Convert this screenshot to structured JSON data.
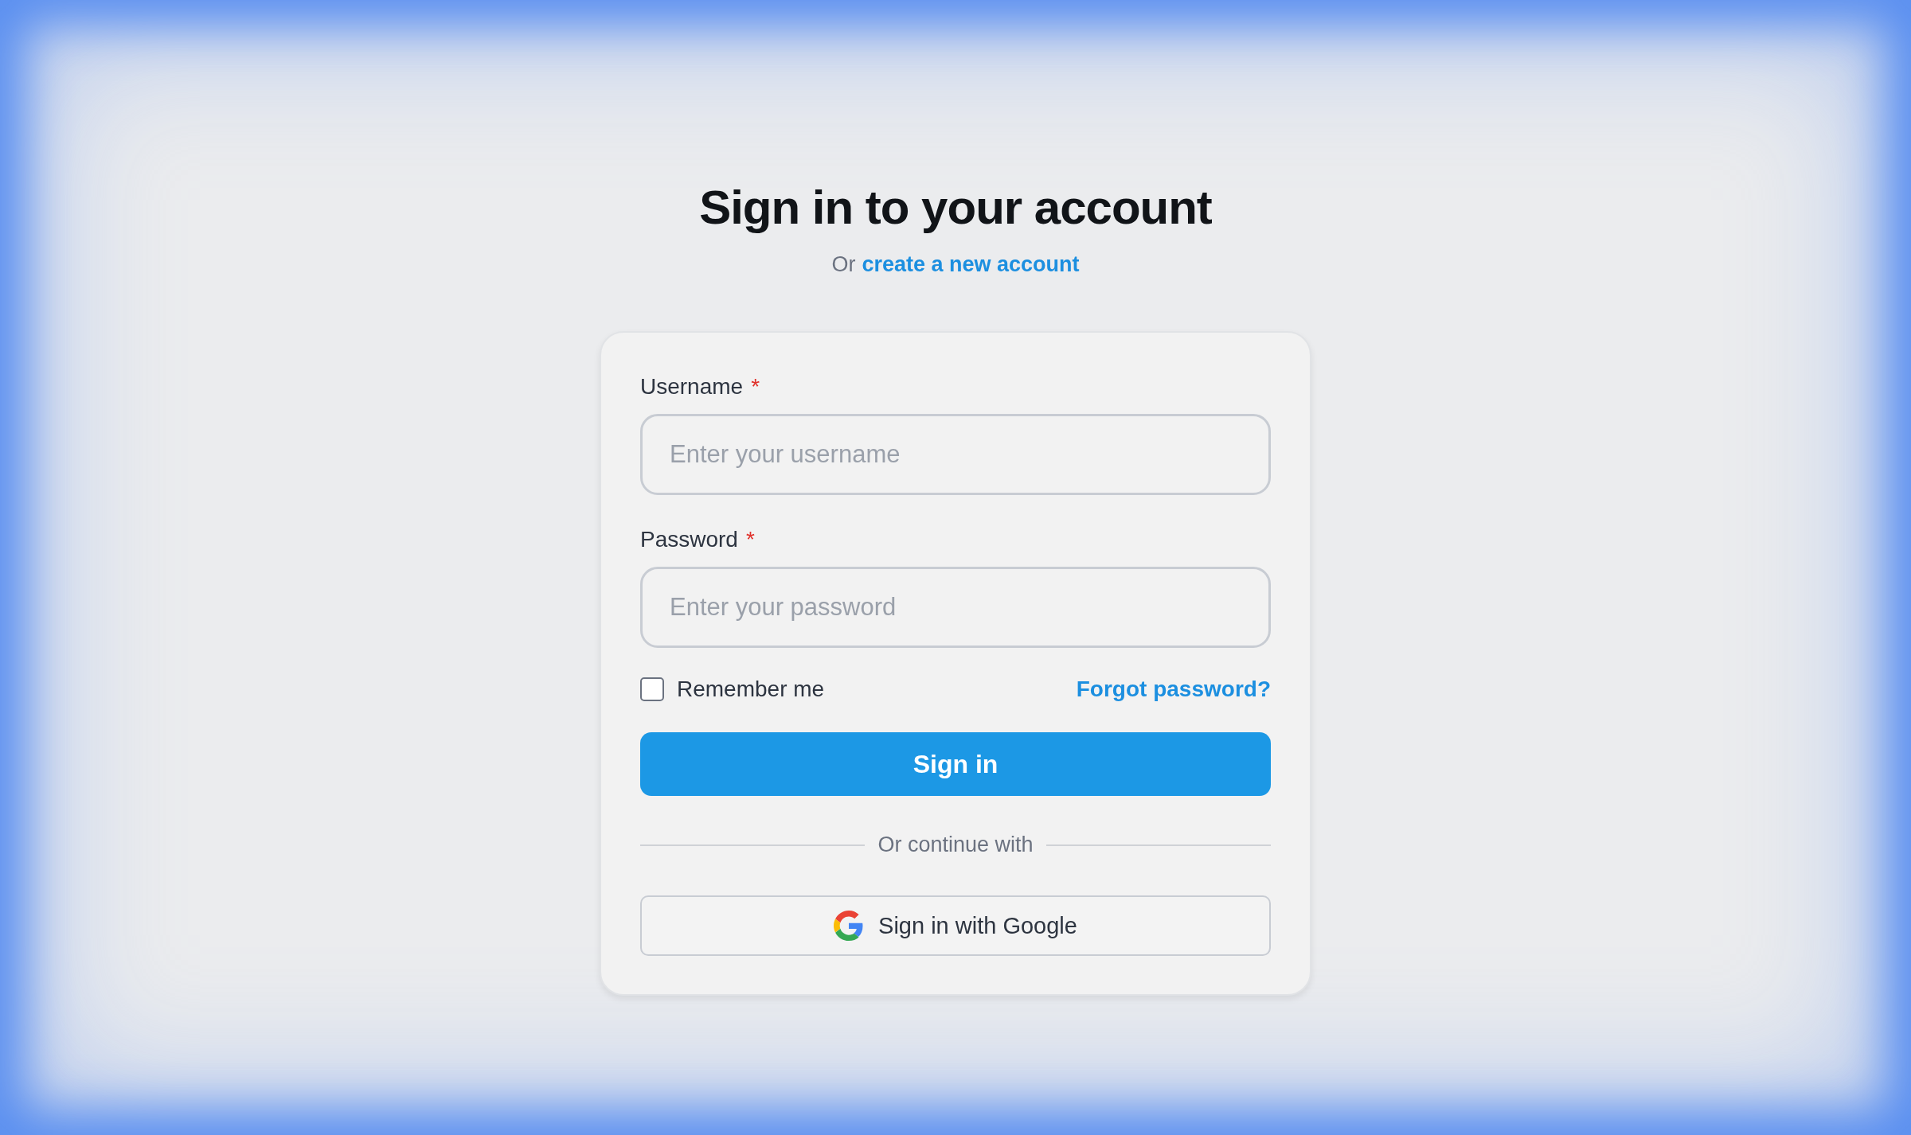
{
  "title": "Sign in to your account",
  "subtitle": {
    "prefix": "Or",
    "link": "create a new account"
  },
  "fields": [
    {
      "label": "Username",
      "required": true,
      "required_mark": "*",
      "placeholder": "Enter your username"
    },
    {
      "label": "Password",
      "required": true,
      "required_mark": "*",
      "placeholder": "Enter your password"
    }
  ],
  "remember": {
    "label": "Remember me",
    "checked": false
  },
  "forgot_link": "Forgot password?",
  "submit": "Sign in",
  "divider": "Or continue with",
  "social_button": {
    "label": "Sign in with Google"
  }
}
